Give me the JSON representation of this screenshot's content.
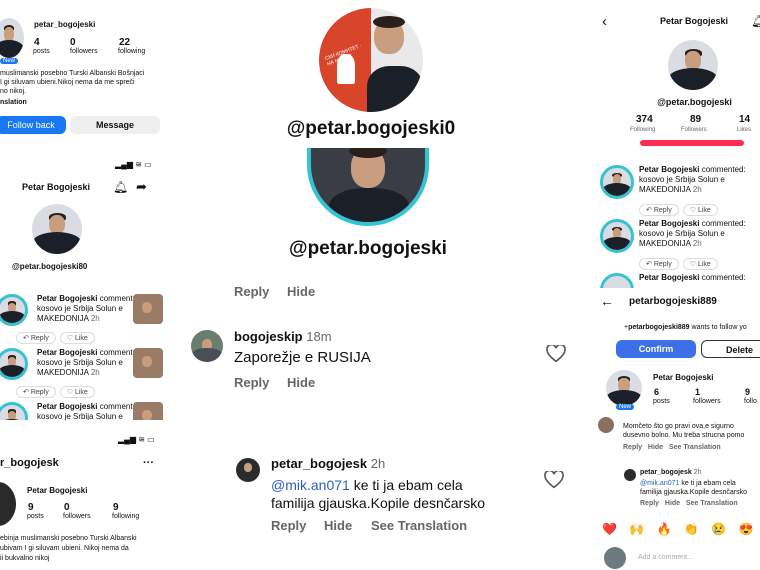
{
  "p1": {
    "name": "petar_bogojeski",
    "posts": "4",
    "posts_label": "posts",
    "followers": "0",
    "followers_label": "followers",
    "following": "22",
    "following_label": "following",
    "bio_line1": "muslimanski posebno Turski Albanski Bošnjaci",
    "bio_line2": "I gi siluvam ubieni.Nikoj nema da me spreči",
    "bio_line3": "no nikoj.",
    "translation": "nslation",
    "follow_back": "Follow back",
    "message": "Message",
    "new_badge": "New"
  },
  "p2": {
    "title": "Petar Bogojeski",
    "username": "@petar.bogojeski80",
    "comments": [
      {
        "name": "Petar Bogojeski",
        "action": " commented:",
        "line1": "kosovo je Srbija Solun e",
        "line2": "MAKEDONIJA",
        "time": "2h",
        "reply": "Reply",
        "like": "Like"
      },
      {
        "name": "Petar Bogojeski",
        "action": " commented:",
        "line1": "kosovo je Srbija Solun e",
        "line2": "MAKEDONIJA",
        "time": "2h",
        "reply": "Reply",
        "like": "Like"
      },
      {
        "name": "Petar Bogojeski",
        "action": " commented:",
        "line1": "kosovo je Srbija Solun e",
        "line2": "",
        "time": "",
        "reply": "",
        "like": ""
      }
    ]
  },
  "p3": {
    "username": "r_bogojesk",
    "name": "Petar Bogojeski",
    "posts": "9",
    "posts_label": "posts",
    "followers": "0",
    "followers_label": "followers",
    "following": "9",
    "following_label": "following",
    "bio_line1": "ebinja muslimanski posebno Turski Albanski",
    "bio_line2": "ubivam I gi siluvam ubieni. Nikoj nema da",
    "bio_line3": "ii bukvalno nikoj",
    "more": "···"
  },
  "p4": {
    "username": "@petar.bogojeski0",
    "logo_text": "СКИ КОМИТЕТ · НА НАРОД"
  },
  "p5": {
    "username": "@petar.bogojeski",
    "partial": "___ __ ___"
  },
  "p6": {
    "top_reply": "Reply",
    "top_hide": "Hide",
    "c1_user": "bogojeskip",
    "c1_time": "18m",
    "c1_text": "Zaporežje e RUSIJA",
    "c1_reply": "Reply",
    "c1_hide": "Hide",
    "c2_user": "petar_bogojesk",
    "c2_time": "2h",
    "c2_mention": "@mik.an071",
    "c2_text1": " ke ti ja ebam cela",
    "c2_text2": "familija gjauska.Kopile desnčarsko",
    "c2_reply": "Reply",
    "c2_hide": "Hide",
    "c2_translate": "See Translation"
  },
  "p7": {
    "title": "Petar Bogojeski",
    "username": "@petar.bogojeski",
    "following": "374",
    "following_label": "Following",
    "followers": "89",
    "followers_label": "Followers",
    "likes": "14",
    "likes_label": "Likes",
    "comments": [
      {
        "name": "Petar Bogojeski",
        "action": " commented:",
        "line1": "kosovo je Srbija Solun e",
        "line2": "MAKEDONIJA",
        "time": "2h",
        "reply": "Reply",
        "like": "Like"
      },
      {
        "name": "Petar Bogojeski",
        "action": " commented:",
        "line1": "kosovo je Srbija Solun e",
        "line2": "MAKEDONIJA",
        "time": "2h",
        "reply": "Reply",
        "like": "Like"
      },
      {
        "name": "Petar Bogojeski",
        "action": " commented:",
        "line1": "",
        "line2": "",
        "time": "",
        "reply": "",
        "like": ""
      }
    ]
  },
  "p8": {
    "username": "petarbogojeski889",
    "request_user": "petarbogojeski889",
    "request_text": " wants to follow yo",
    "confirm": "Confirm",
    "delete": "Delete",
    "name": "Petar Bogojeski",
    "posts": "6",
    "posts_label": "posts",
    "followers": "1",
    "followers_label": "followers",
    "following": "9",
    "following_label": "follo",
    "new_badge": "New",
    "c1_line1": "Momčeto što go pravi ova,e sigurno",
    "c1_line2": "dusevno bolno. Mu treba strucna pomo",
    "c1_reply": "Reply",
    "c1_hide": "Hide",
    "c1_translate": "See Translation",
    "c2_user": "petar_bogojesk",
    "c2_time": "2h",
    "c2_mention": "@mik.an071",
    "c2_text1": " ke ti ja ebam cela",
    "c2_text2": "familija gjauska.Kopile desnčarsko",
    "c2_reply": "Reply",
    "c2_hide": "Hide",
    "c2_translate": "See Translation",
    "emojis": [
      "❤️",
      "🙌",
      "🔥",
      "👏",
      "😢",
      "😍",
      "😮"
    ],
    "add_comment": "Add a comment..."
  },
  "colors": {
    "accent_blue": "#1877f2",
    "confirm_blue": "#3d6fe6",
    "ring_teal": "#35c3d3",
    "tiktok_red": "#fe2c55",
    "logo_red": "#d9452b"
  }
}
